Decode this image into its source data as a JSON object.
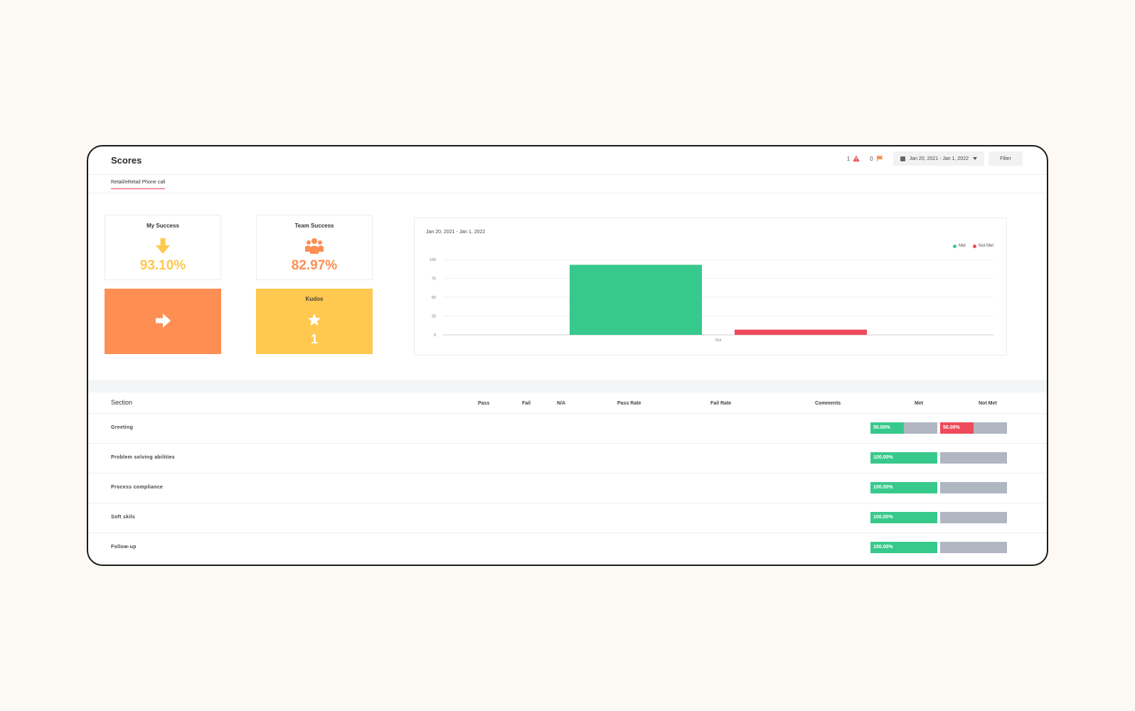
{
  "header": {
    "title": "Scores",
    "alerts_count": "1",
    "flags_count": "0",
    "date_range": "Jan 20, 2021 - Jan 1, 2022",
    "filter_label": "Filter"
  },
  "tabs": [
    {
      "label": "Retail/eRetail Phone call"
    }
  ],
  "cards": {
    "my_success": {
      "title": "My Success",
      "value": "93.10%",
      "icon": "arrow-down-icon"
    },
    "team_success": {
      "title": "Team Success",
      "value": "82.97%",
      "icon": "team-icon"
    },
    "action_tile": {
      "icon": "arrow-right-icon"
    },
    "kudos": {
      "title": "Kudos",
      "value": "1",
      "icon": "star-icon"
    }
  },
  "colors": {
    "met": "#37c98b",
    "not_met": "#ee4a5b",
    "orange": "#fe8e52",
    "yellow": "#ffc84e",
    "my_success_value": "#ffc84e",
    "team_success_value": "#fe8e52"
  },
  "chart_data": {
    "type": "bar",
    "title": "Jan 20, 2021 - Jan 1, 2022",
    "categories": [
      "Oct"
    ],
    "series": [
      {
        "name": "Met",
        "values": [
          93
        ]
      },
      {
        "name": "Not Met",
        "values": [
          7
        ]
      }
    ],
    "yticks": [
      "100",
      "75",
      "50",
      "25",
      "0"
    ],
    "ylim": [
      0,
      100
    ],
    "grid": true,
    "legend": "top-right"
  },
  "table": {
    "section_label": "Section",
    "columns": [
      "Pass",
      "Fail",
      "N/A",
      "Pass Rate",
      "Fail Rate",
      "Comments",
      "Met",
      "Not Met"
    ],
    "rows": [
      {
        "section": "Greeting",
        "met": 0.5,
        "met_label": "50.00%",
        "not_met": 0.5,
        "not_met_label": "50.00%"
      },
      {
        "section": "Problem solving abilities",
        "met": 1.0,
        "met_label": "100.00%",
        "not_met": 0,
        "not_met_label": ""
      },
      {
        "section": "Process compliance",
        "met": 1.0,
        "met_label": "100.00%",
        "not_met": 0,
        "not_met_label": ""
      },
      {
        "section": "Soft skils",
        "met": 1.0,
        "met_label": "100.00%",
        "not_met": 0,
        "not_met_label": ""
      },
      {
        "section": "Follow-up",
        "met": 1.0,
        "met_label": "100.00%",
        "not_met": 0,
        "not_met_label": ""
      }
    ]
  }
}
